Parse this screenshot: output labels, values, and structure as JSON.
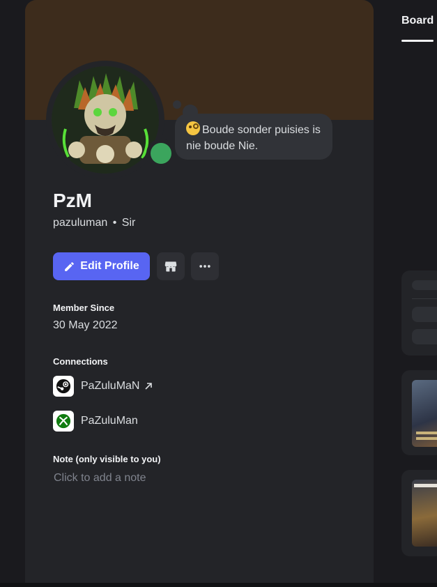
{
  "profile": {
    "display_name": "PzM",
    "username": "pazuluman",
    "separator": "•",
    "pronouns": "Sir",
    "custom_status": "Boude sonder puisies is nie boude Nie.",
    "status_color": "#3ba55d",
    "banner_color": "#3d2c1c"
  },
  "actions": {
    "edit_profile_label": "Edit Profile",
    "shop_icon": "shop-icon",
    "more_icon": "more-icon"
  },
  "member_since": {
    "title": "Member Since",
    "date": "30 May 2022"
  },
  "connections": {
    "title": "Connections",
    "items": [
      {
        "platform": "steam",
        "name": "PaZuluMaN",
        "icon": "steam-icon",
        "external": true
      },
      {
        "platform": "xbox",
        "name": "PaZuluMan",
        "icon": "xbox-icon",
        "external": false
      }
    ]
  },
  "note": {
    "title": "Note (only visible to you)",
    "placeholder": "Click to add a note"
  },
  "side_panel": {
    "tab_label": "Board"
  },
  "colors": {
    "accent": "#5865f2",
    "card_bg": "#232428"
  }
}
